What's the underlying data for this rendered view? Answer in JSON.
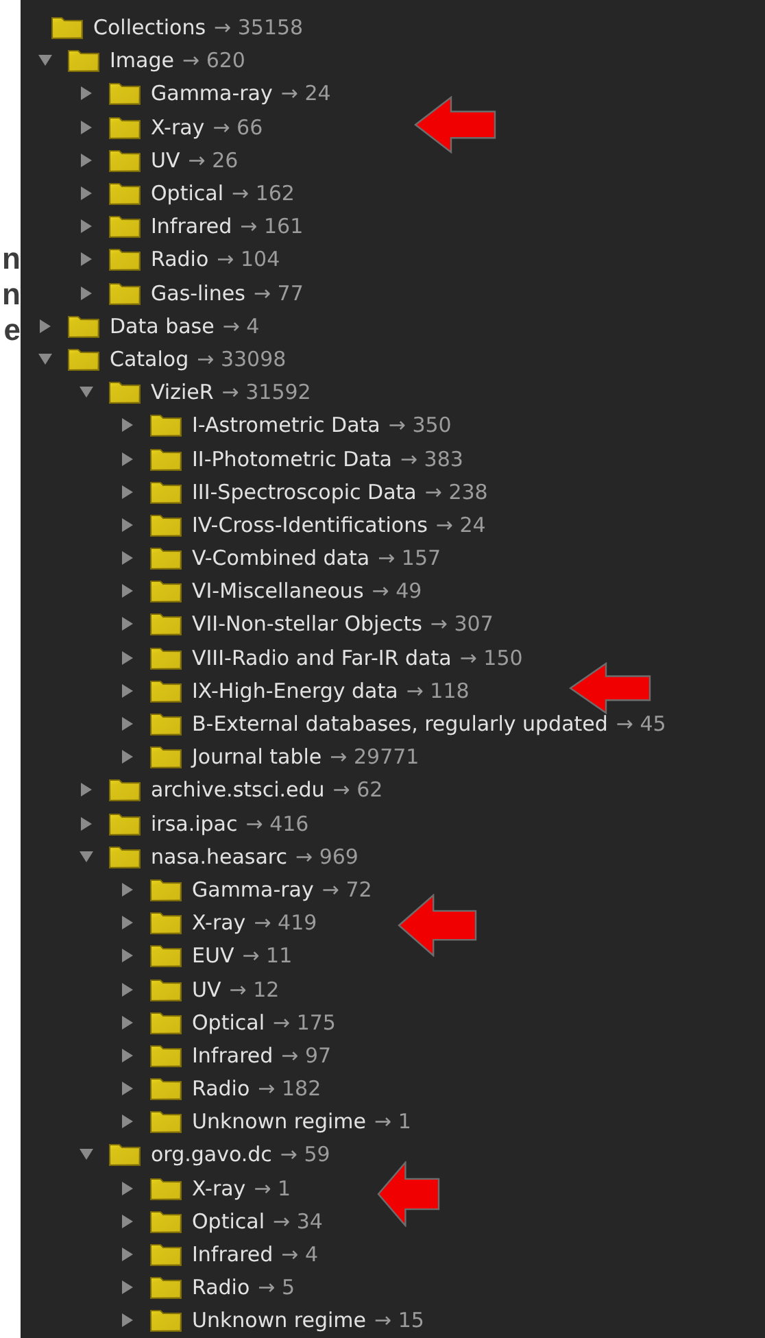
{
  "margin_letters": [
    "n",
    "n",
    "e"
  ],
  "tree": {
    "label": "Collections",
    "count": "→ 35158",
    "children": [
      {
        "label": "Image",
        "count": "→ 620",
        "expanded": true,
        "children": [
          {
            "label": "Gamma-ray",
            "count": "→ 24",
            "expanded": false
          },
          {
            "label": "X-ray",
            "count": "→ 66",
            "expanded": false
          },
          {
            "label": "UV",
            "count": "→ 26",
            "expanded": false
          },
          {
            "label": "Optical",
            "count": "→ 162",
            "expanded": false
          },
          {
            "label": "Infrared",
            "count": "→ 161",
            "expanded": false
          },
          {
            "label": "Radio",
            "count": "→ 104",
            "expanded": false
          },
          {
            "label": "Gas-lines",
            "count": "→ 77",
            "expanded": false
          }
        ]
      },
      {
        "label": "Data base",
        "count": "→ 4",
        "expanded": false
      },
      {
        "label": "Catalog",
        "count": "→ 33098",
        "expanded": true,
        "children": [
          {
            "label": "VizieR",
            "count": "→ 31592",
            "expanded": true,
            "children": [
              {
                "label": "I-Astrometric Data",
                "count": "→ 350",
                "expanded": false
              },
              {
                "label": "II-Photometric Data",
                "count": "→ 383",
                "expanded": false
              },
              {
                "label": "III-Spectroscopic Data",
                "count": "→ 238",
                "expanded": false
              },
              {
                "label": "IV-Cross-Identifications",
                "count": "→ 24",
                "expanded": false
              },
              {
                "label": "V-Combined data",
                "count": "→ 157",
                "expanded": false
              },
              {
                "label": "VI-Miscellaneous",
                "count": "→ 49",
                "expanded": false
              },
              {
                "label": "VII-Non-stellar Objects",
                "count": "→ 307",
                "expanded": false
              },
              {
                "label": "VIII-Radio and Far-IR data",
                "count": "→ 150",
                "expanded": false
              },
              {
                "label": "IX-High-Energy data",
                "count": "→ 118",
                "expanded": false
              },
              {
                "label": "B-External databases, regularly updated",
                "count": "→ 45",
                "expanded": false
              },
              {
                "label": "Journal table",
                "count": "→ 29771",
                "expanded": false
              }
            ]
          },
          {
            "label": "archive.stsci.edu",
            "count": "→ 62",
            "expanded": false
          },
          {
            "label": "irsa.ipac",
            "count": "→ 416",
            "expanded": false
          },
          {
            "label": "nasa.heasarc",
            "count": "→ 969",
            "expanded": true,
            "children": [
              {
                "label": "Gamma-ray",
                "count": "→ 72",
                "expanded": false
              },
              {
                "label": "X-ray",
                "count": "→ 419",
                "expanded": false
              },
              {
                "label": "EUV",
                "count": "→ 11",
                "expanded": false
              },
              {
                "label": "UV",
                "count": "→ 12",
                "expanded": false
              },
              {
                "label": "Optical",
                "count": "→ 175",
                "expanded": false
              },
              {
                "label": "Infrared",
                "count": "→ 97",
                "expanded": false
              },
              {
                "label": "Radio",
                "count": "→ 182",
                "expanded": false
              },
              {
                "label": "Unknown regime",
                "count": "→ 1",
                "expanded": false
              }
            ]
          },
          {
            "label": "org.gavo.dc",
            "count": "→ 59",
            "expanded": true,
            "children": [
              {
                "label": "X-ray",
                "count": "→ 1",
                "expanded": false
              },
              {
                "label": "Optical",
                "count": "→ 34",
                "expanded": false
              },
              {
                "label": "Infrared",
                "count": "→ 4",
                "expanded": false
              },
              {
                "label": "Radio",
                "count": "→ 5",
                "expanded": false
              },
              {
                "label": "Unknown regime",
                "count": "→ 15",
                "expanded": false
              }
            ]
          }
        ]
      }
    ]
  }
}
